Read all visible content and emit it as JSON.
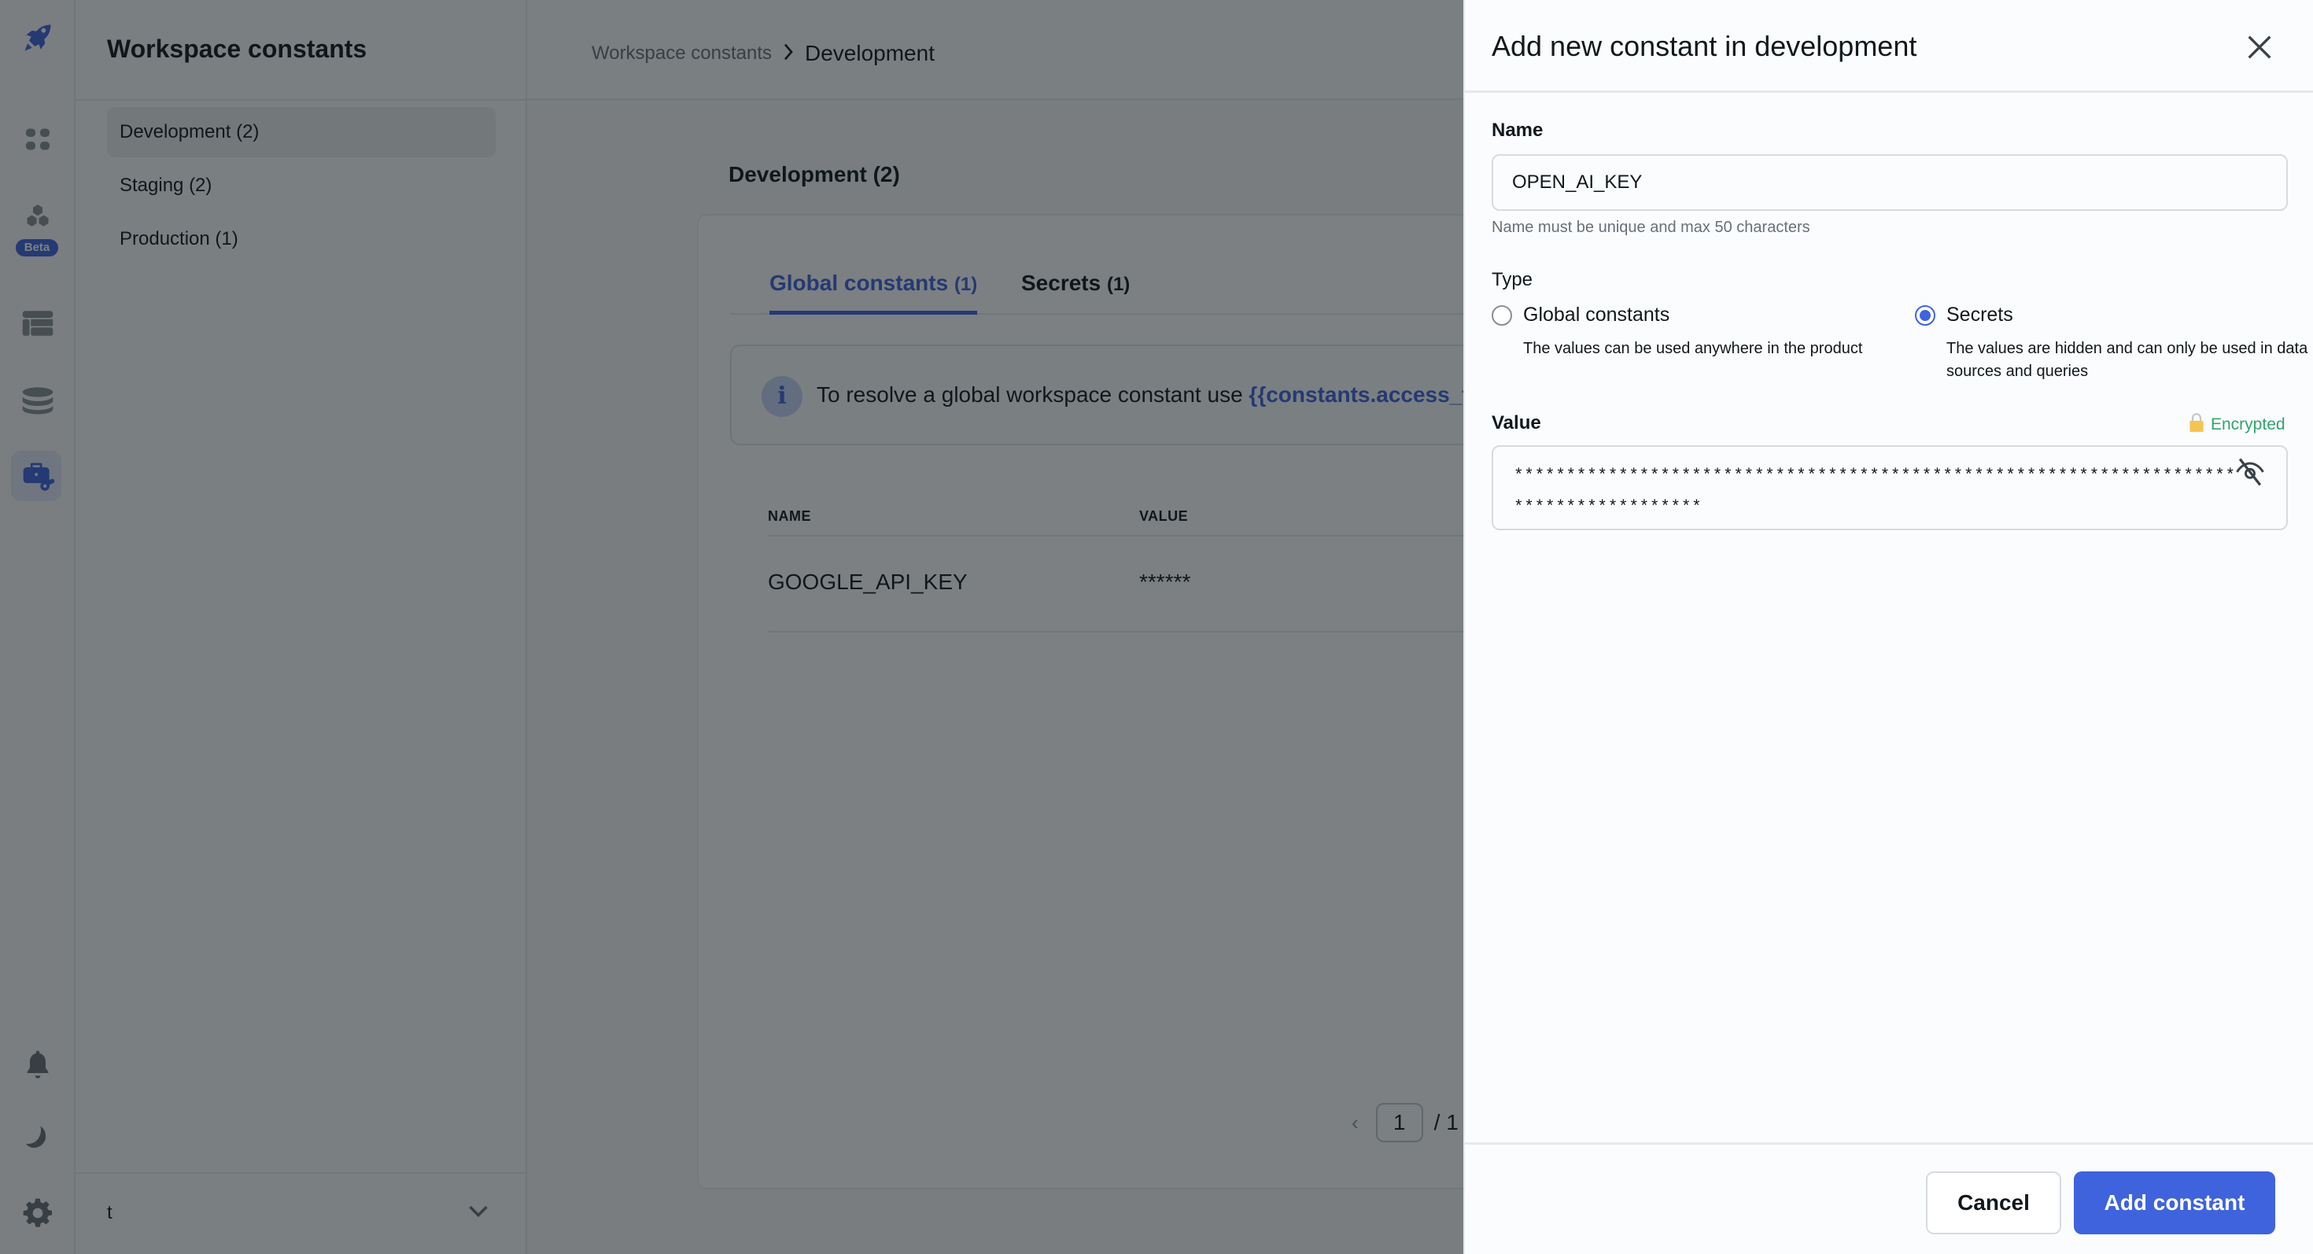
{
  "sidebar": {
    "icons": [
      "rocket-logo",
      "apps-grid",
      "workflows",
      "tables",
      "database",
      "workspace-constants",
      "notifications",
      "theme-toggle",
      "settings"
    ],
    "beta_badge": "Beta"
  },
  "left_panel": {
    "title": "Workspace constants",
    "environments": [
      {
        "label": "Development (2)",
        "active": true
      },
      {
        "label": "Staging (2)",
        "active": false
      },
      {
        "label": "Production (1)",
        "active": false
      }
    ],
    "workspace_name": "t"
  },
  "header": {
    "breadcrumb_parent": "Workspace constants",
    "breadcrumb_current": "Development"
  },
  "main": {
    "section_title": "Development (2)",
    "tabs": [
      {
        "label": "Global constants",
        "count": "(1)",
        "active": true
      },
      {
        "label": "Secrets",
        "count": "(1)",
        "active": false
      }
    ],
    "info_text": "To resolve a global workspace constant use",
    "info_code": "{{constants.access_to",
    "table": {
      "columns": [
        "NAME",
        "VALUE"
      ],
      "rows": [
        {
          "name": "GOOGLE_API_KEY",
          "value": "******"
        }
      ]
    },
    "pagination": {
      "prev": "‹",
      "current_page": "1",
      "total": "/ 1"
    }
  },
  "drawer": {
    "title": "Add new constant in development",
    "name_label": "Name",
    "name_value": "OPEN_AI_KEY",
    "name_hint": "Name must be unique and max 50 characters",
    "type_label": "Type",
    "types": [
      {
        "label": "Global constants",
        "description": "The values can be used anywhere in the product",
        "checked": false
      },
      {
        "label": "Secrets",
        "description": "The values are hidden and can only be used in data sources and queries",
        "checked": true
      }
    ],
    "value_label": "Value",
    "encrypted_label": "Encrypted",
    "value_masked": "***************************************************************************************",
    "cancel_label": "Cancel",
    "submit_label": "Add constant"
  },
  "colors": {
    "accent": "#3e63dd",
    "encrypted_green": "#30a46c",
    "lock_yellow": "#f5c451"
  }
}
